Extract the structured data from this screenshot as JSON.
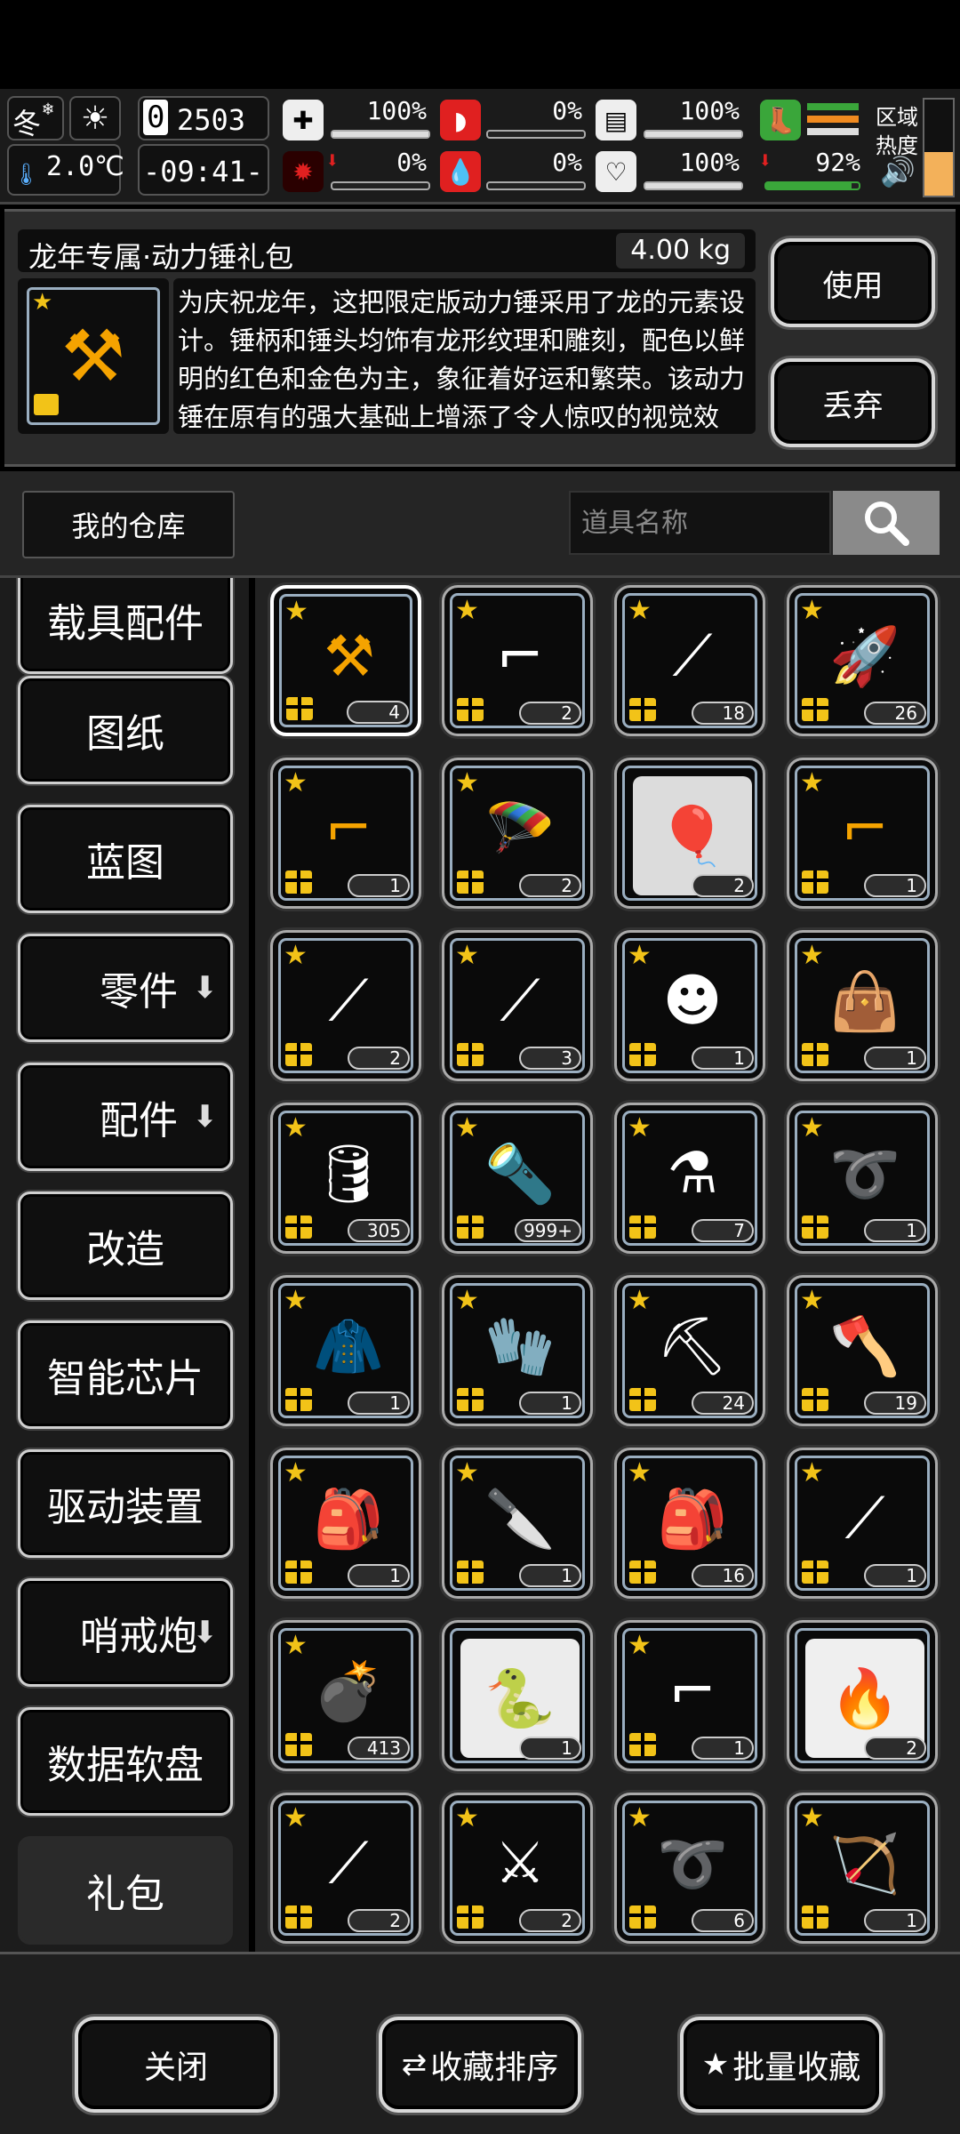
{
  "status": {
    "season": "冬",
    "temperature": "2.0℃",
    "day_counter": "2503",
    "day_digit": "0",
    "time": "-09:41-",
    "health_pct": "100%",
    "stomach_pct": "0%",
    "stamina_pct": "100%",
    "disease_pct": "0%",
    "blood_pct": "0%",
    "heart_pct": "100%",
    "battery_pct": "92%",
    "region_label": "区域",
    "heat_label": "热度",
    "levels": {
      "health": 1.0,
      "stomach": 0.0,
      "stamina": 1.0,
      "disease": 0.0,
      "blood": 0.0,
      "heart": 1.0,
      "battery": 0.92
    }
  },
  "detail": {
    "name": "龙年专属·动力锤礼包",
    "weight": "4.00 kg",
    "description": "为庆祝龙年，这把限定版动力锤采用了龙的元素设计。锤柄和锤头均饰有龙形纹理和雕刻，配色以鲜明的红色和金色为主，象征着好运和繁荣。该动力锤在原有的强大基础上增添了令人惊叹的视觉效果，气派挥动或击中目标时，锤头会发出",
    "use_label": "使用",
    "discard_label": "丢弃"
  },
  "storage": {
    "title": "我的仓库",
    "search_placeholder": "道具名称"
  },
  "sidebar": {
    "items": [
      {
        "label": "载具配件",
        "arrow": false
      },
      {
        "label": "图纸",
        "arrow": false
      },
      {
        "label": "蓝图",
        "arrow": false
      },
      {
        "label": "零件",
        "arrow": true
      },
      {
        "label": "配件",
        "arrow": true
      },
      {
        "label": "改造",
        "arrow": false
      },
      {
        "label": "智能芯片",
        "arrow": false
      },
      {
        "label": "驱动装置",
        "arrow": false
      },
      {
        "label": "哨戒炮",
        "arrow": true
      },
      {
        "label": "数据软盘",
        "arrow": false
      },
      {
        "label": "礼包",
        "arrow": false
      }
    ]
  },
  "grid": {
    "items": [
      {
        "count": "4",
        "icon": "power-hammer-icon",
        "glyph": "⚒",
        "color": "#f5a300",
        "selected": true
      },
      {
        "count": "2",
        "icon": "machine-gun-icon",
        "glyph": "⌐",
        "color": "#ffffff"
      },
      {
        "count": "18",
        "icon": "fishing-rod-icon",
        "glyph": "⟋",
        "color": "#ffffff"
      },
      {
        "count": "26",
        "icon": "firework-rocket-icon",
        "glyph": "🚀",
        "color": "#ffffff"
      },
      {
        "count": "1",
        "icon": "golden-rifle-icon",
        "glyph": "⌐",
        "color": "#f5a300"
      },
      {
        "count": "2",
        "icon": "airdrop-car-icon",
        "glyph": "🪂",
        "color": "#ffffff",
        "photo": false
      },
      {
        "count": "2",
        "icon": "hot-air-balloon-icon",
        "glyph": "🎈",
        "color": "#999999",
        "photo": true,
        "bg": "#dcdcdc"
      },
      {
        "count": "1",
        "icon": "golden-blaster-icon",
        "glyph": "⌐",
        "color": "#f5a300"
      },
      {
        "count": "2",
        "icon": "katana-icon",
        "glyph": "⟋",
        "color": "#ffffff"
      },
      {
        "count": "3",
        "icon": "curved-blade-icon",
        "glyph": "⟋",
        "color": "#ffffff"
      },
      {
        "count": "1",
        "icon": "tiger-mask-icon",
        "glyph": "☻",
        "color": "#ffffff"
      },
      {
        "count": "1",
        "icon": "duffel-bag-icon",
        "glyph": "👜",
        "color": "#ffffff"
      },
      {
        "count": "305",
        "icon": "fuel-canister-icon",
        "glyph": "🛢",
        "color": "#ffffff"
      },
      {
        "count": "999+",
        "icon": "flashlight-icon",
        "glyph": "🔦",
        "color": "#ffffff"
      },
      {
        "count": "7",
        "icon": "spray-bottle-icon",
        "glyph": "⚗",
        "color": "#ffffff"
      },
      {
        "count": "1",
        "icon": "rope-coil-icon",
        "glyph": "➰",
        "color": "#ffffff"
      },
      {
        "count": "1",
        "icon": "jacket-icon",
        "glyph": "🧥",
        "color": "#ffffff"
      },
      {
        "count": "1",
        "icon": "glove-icon",
        "glyph": "🧤",
        "color": "#ffffff"
      },
      {
        "count": "24",
        "icon": "shovel-icon",
        "glyph": "⛏",
        "color": "#ffffff"
      },
      {
        "count": "19",
        "icon": "axe-icon",
        "glyph": "🪓",
        "color": "#ffffff"
      },
      {
        "count": "1",
        "icon": "backpack-icon",
        "glyph": "🎒",
        "color": "#ffffff"
      },
      {
        "count": "1",
        "icon": "knife-icon",
        "glyph": "🔪",
        "color": "#ffffff"
      },
      {
        "count": "16",
        "icon": "large-backpack-icon",
        "glyph": "🎒",
        "color": "#ffffff"
      },
      {
        "count": "1",
        "icon": "rocket-launcher-icon",
        "glyph": "⟋",
        "color": "#ffffff"
      },
      {
        "count": "413",
        "icon": "grenade-canister-icon",
        "glyph": "💣",
        "color": "#ffffff"
      },
      {
        "count": "1",
        "icon": "snake-head-icon",
        "glyph": "🐍",
        "color": "#6aa84f",
        "photo": true,
        "bg": "#ececec"
      },
      {
        "count": "1",
        "icon": "heavy-gun-icon",
        "glyph": "⌐",
        "color": "#ffffff"
      },
      {
        "count": "2",
        "icon": "phoenix-wings-icon",
        "glyph": "🔥",
        "color": "#c9802a",
        "photo": true,
        "bg": "#efefef"
      },
      {
        "count": "2",
        "icon": "dragon-spear-icon",
        "glyph": "⟋",
        "color": "#ffffff"
      },
      {
        "count": "2",
        "icon": "dragon-crossbow-icon",
        "glyph": "⚔",
        "color": "#ffffff"
      },
      {
        "count": "6",
        "icon": "dragon-whip-icon",
        "glyph": "➰",
        "color": "#ffffff"
      },
      {
        "count": "1",
        "icon": "dragon-bow-icon",
        "glyph": "🏹",
        "color": "#ffffff"
      }
    ]
  },
  "bottom": {
    "close_label": "关闭",
    "sort_label": "收藏排序",
    "batch_label": "批量收藏"
  }
}
